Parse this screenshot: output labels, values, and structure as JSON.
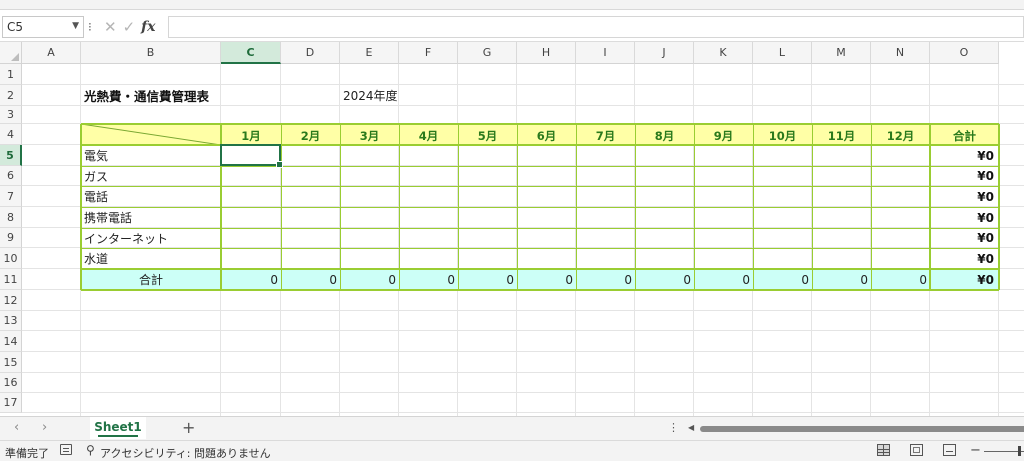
{
  "formula_bar": {
    "name_box": "C5",
    "fx_label": "fx",
    "formula": ""
  },
  "columns": [
    "A",
    "B",
    "C",
    "D",
    "E",
    "F",
    "G",
    "H",
    "I",
    "J",
    "K",
    "L",
    "M",
    "N",
    "O"
  ],
  "rows": [
    "1",
    "2",
    "3",
    "4",
    "5",
    "6",
    "7",
    "8",
    "9",
    "10",
    "11",
    "12",
    "13",
    "14",
    "15",
    "16",
    "17"
  ],
  "selected_column": "C",
  "selected_row": "5",
  "sheet": {
    "title": "光熱費・通信費管理表",
    "year": "2024年度",
    "months": [
      "1月",
      "2月",
      "3月",
      "4月",
      "5月",
      "6月",
      "7月",
      "8月",
      "9月",
      "10月",
      "11月",
      "12月"
    ],
    "total_header": "合計",
    "items": [
      {
        "label": "電気",
        "total": "¥0"
      },
      {
        "label": "ガス",
        "total": "¥0"
      },
      {
        "label": "電話",
        "total": "¥0"
      },
      {
        "label": "携帯電話",
        "total": "¥0"
      },
      {
        "label": "インターネット",
        "total": "¥0"
      },
      {
        "label": "水道",
        "total": "¥0"
      }
    ],
    "total_row": {
      "label": "合計",
      "values": [
        "0",
        "0",
        "0",
        "0",
        "0",
        "0",
        "0",
        "0",
        "0",
        "0",
        "0",
        "0"
      ],
      "grand_total": "¥0"
    }
  },
  "tabs": {
    "sheet_name": "Sheet1",
    "add_label": "+"
  },
  "status": {
    "ready": "準備完了",
    "accessibility": "アクセシビリティ: 問題ありません"
  },
  "colors": {
    "header_fill": "#ffffa6",
    "total_fill": "#ccfff7",
    "table_border": "#9acd32",
    "accent": "#217346"
  }
}
